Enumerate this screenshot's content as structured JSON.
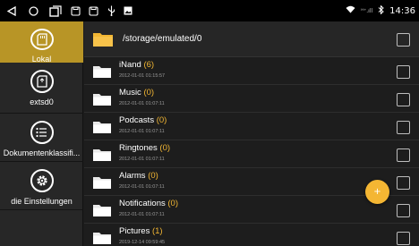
{
  "statusbar": {
    "time": "14:36",
    "signal_text": "ᴴ⁺.ıll",
    "icons": [
      "back-icon",
      "home-icon",
      "recents-icon",
      "screenshot-icon",
      "screenshot-icon",
      "usb-icon",
      "image-icon",
      "wifi-icon",
      "signal-icon",
      "bluetooth-icon"
    ]
  },
  "sidebar": {
    "items": [
      {
        "label": "Lokal",
        "icon": "sd-card-icon",
        "active": true
      },
      {
        "label": "extsd0",
        "icon": "sd-card-icon",
        "active": false
      },
      {
        "label": "Dokumentenklassifi...",
        "icon": "list-icon",
        "active": false
      },
      {
        "label": "die Einstellungen",
        "icon": "gear-icon",
        "active": false
      }
    ]
  },
  "main": {
    "path": "/storage/emulated/0",
    "rows": [
      {
        "name": "iNand",
        "count": "(6)",
        "date": "2012-01-01 01:15:57"
      },
      {
        "name": "Music",
        "count": "(0)",
        "date": "2012-01-01 01:07:11"
      },
      {
        "name": "Podcasts",
        "count": "(0)",
        "date": "2012-01-01 01:07:11"
      },
      {
        "name": "Ringtones",
        "count": "(0)",
        "date": "2012-01-01 01:07:11"
      },
      {
        "name": "Alarms",
        "count": "(0)",
        "date": "2012-01-01 01:07:11"
      },
      {
        "name": "Notifications",
        "count": "(0)",
        "date": "2012-01-01 01:07:11"
      },
      {
        "name": "Pictures",
        "count": "(1)",
        "date": "2019-12-14 09:59:45"
      }
    ],
    "fab_label": "+"
  },
  "colors": {
    "accent": "#f2b633",
    "sidebar_active": "#b89526",
    "background": "#1d1d1d"
  }
}
